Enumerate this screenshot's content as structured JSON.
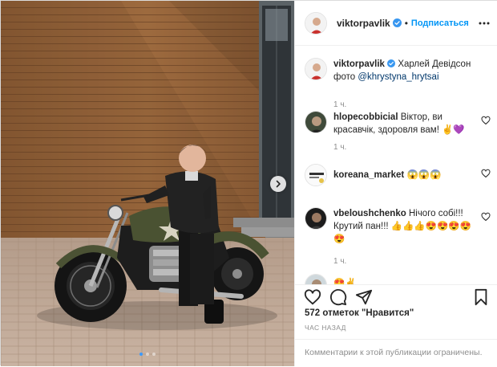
{
  "post": {
    "author": {
      "username": "viktorpavlik",
      "verified": true,
      "follow_label": "Подписаться",
      "separator": "•"
    },
    "caption": {
      "username": "viktorpavlik",
      "text": "Харлей Девідсон фото ",
      "mention": "@khrystyna_hrytsai",
      "time": "1 ч."
    },
    "comments": [
      {
        "username": "hlopecobbicial",
        "text": "Віктор, ви красавчік, здоровля вам! ✌️💜",
        "time": "1 ч."
      },
      {
        "username": "koreana_market",
        "text": "😱😱😱",
        "time": ""
      },
      {
        "username": "vbeloushchenko",
        "text": "Нічого собі!!! Крутий пан!!! 👍👍👍😍😍😍😍😍",
        "time": "1 ч."
      },
      {
        "username": "",
        "text": "😍✌️",
        "time": ""
      }
    ],
    "likes_label": "572 отметок \"Нравится\"",
    "time_ago": "ЧАС НАЗАД",
    "comments_disabled": "Комментарии к этой публикации ограничены.",
    "carousel": {
      "count": 3,
      "active": 0
    },
    "colors": {
      "accent": "#0095f6",
      "verified": "#3897f0",
      "muted": "#8e8e8e"
    },
    "icons": [
      "verified-icon",
      "more-options-icon",
      "heart-icon",
      "comment-icon",
      "share-icon",
      "bookmark-icon",
      "chevron-right-icon"
    ]
  }
}
